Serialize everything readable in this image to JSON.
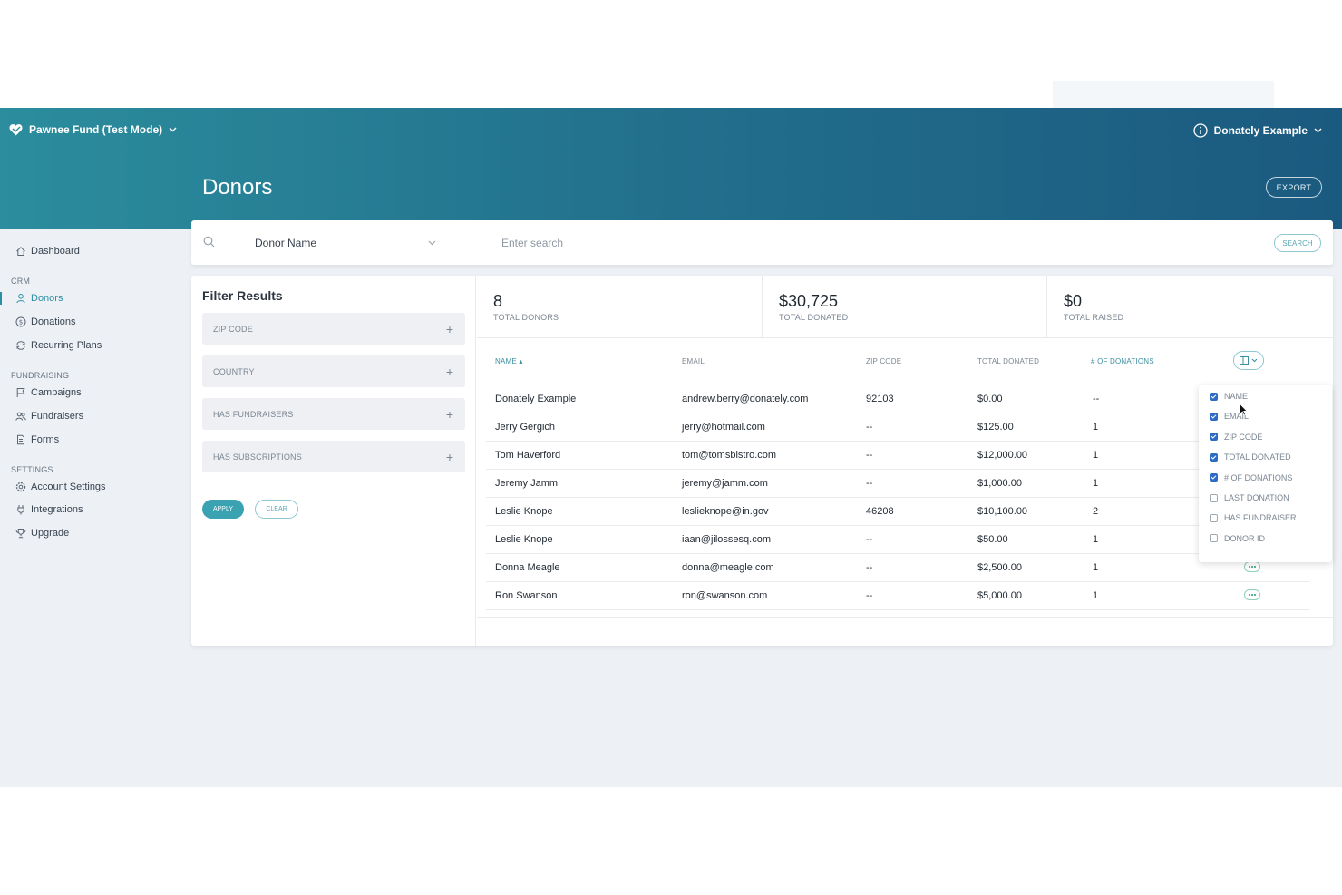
{
  "header": {
    "org_name": "Pawnee Fund (Test Mode)",
    "account_name": "Donately Example",
    "page_title": "Donors",
    "export_label": "EXPORT"
  },
  "sidebar": {
    "items": [
      {
        "label": "Dashboard",
        "icon": "home-icon"
      },
      {
        "section": "CRM"
      },
      {
        "label": "Donors",
        "icon": "person-icon",
        "active": true
      },
      {
        "label": "Donations",
        "icon": "dollar-circle-icon"
      },
      {
        "label": "Recurring Plans",
        "icon": "repeat-icon"
      },
      {
        "section": "FUNDRAISING"
      },
      {
        "label": "Campaigns",
        "icon": "flag-icon"
      },
      {
        "label": "Fundraisers",
        "icon": "people-icon"
      },
      {
        "label": "Forms",
        "icon": "document-icon"
      },
      {
        "section": "SETTINGS"
      },
      {
        "label": "Account Settings",
        "icon": "gear-icon"
      },
      {
        "label": "Integrations",
        "icon": "plug-icon"
      },
      {
        "label": "Upgrade",
        "icon": "trophy-icon"
      }
    ]
  },
  "search": {
    "field": "Donor Name",
    "placeholder": "Enter search",
    "button_label": "SEARCH"
  },
  "filters": {
    "title": "Filter Results",
    "rows": [
      "ZIP CODE",
      "COUNTRY",
      "HAS FUNDRAISERS",
      "HAS SUBSCRIPTIONS"
    ],
    "apply_label": "APPLY",
    "clear_label": "CLEAR"
  },
  "stats": [
    {
      "value": "8",
      "label": "TOTAL DONORS"
    },
    {
      "value": "$30,725",
      "label": "TOTAL DONATED"
    },
    {
      "value": "$0",
      "label": "TOTAL RAISED"
    }
  ],
  "table": {
    "columns": [
      "NAME",
      "EMAIL",
      "ZIP CODE",
      "TOTAL DONATED",
      "# OF DONATIONS"
    ],
    "rows": [
      [
        "Donately Example",
        "andrew.berry@donately.com",
        "92103",
        "$0.00",
        "--"
      ],
      [
        "Jerry Gergich",
        "jerry@hotmail.com",
        "--",
        "$125.00",
        "1"
      ],
      [
        "Tom Haverford",
        "tom@tomsbistro.com",
        "--",
        "$12,000.00",
        "1"
      ],
      [
        "Jeremy Jamm",
        "jeremy@jamm.com",
        "--",
        "$1,000.00",
        "1"
      ],
      [
        "Leslie Knope",
        "leslieknope@in.gov",
        "46208",
        "$10,100.00",
        "2"
      ],
      [
        "Leslie Knope",
        "iaan@jilossesq.com",
        "--",
        "$50.00",
        "1"
      ],
      [
        "Donna Meagle",
        "donna@meagle.com",
        "--",
        "$2,500.00",
        "1"
      ],
      [
        "Ron Swanson",
        "ron@swanson.com",
        "--",
        "$5,000.00",
        "1"
      ]
    ]
  },
  "column_menu": {
    "options": [
      {
        "label": "NAME",
        "checked": true
      },
      {
        "label": "EMAIL",
        "checked": true
      },
      {
        "label": "ZIP CODE",
        "checked": true
      },
      {
        "label": "TOTAL DONATED",
        "checked": true
      },
      {
        "label": "# OF DONATIONS",
        "checked": true
      },
      {
        "label": "LAST DONATION",
        "checked": false
      },
      {
        "label": "HAS FUNDRAISER",
        "checked": false
      },
      {
        "label": "DONOR ID",
        "checked": false
      }
    ]
  },
  "colors": {
    "header_start": "#2b8d9d",
    "header_end": "#1b5a80",
    "accent": "#2a8fa3",
    "checkbox": "#2d6cc6"
  }
}
